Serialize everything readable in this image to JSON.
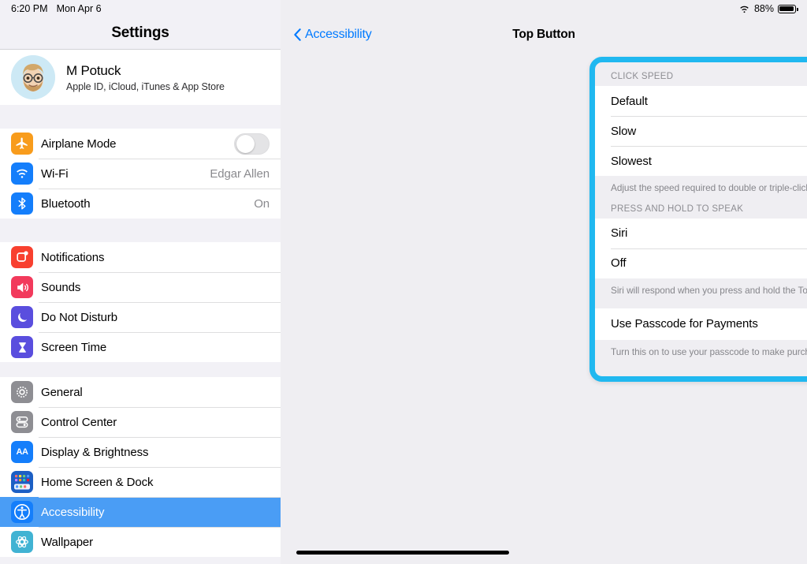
{
  "status_bar": {
    "time": "6:20 PM",
    "date": "Mon Apr 6",
    "wifi_icon": "wifi-icon",
    "battery_percent": "88%",
    "battery_icon": "battery-icon"
  },
  "sidebar": {
    "title": "Settings",
    "profile": {
      "name": "M Potuck",
      "subtitle": "Apple ID, iCloud, iTunes & App Store",
      "avatar_icon": "memoji-avatar"
    },
    "groups": [
      {
        "items": [
          {
            "label": "Airplane Mode",
            "icon": "airplane-icon",
            "icon_color": "#f89c1c",
            "control": "toggle",
            "toggle_on": false,
            "value": ""
          },
          {
            "label": "Wi-Fi",
            "icon": "wifi-icon",
            "icon_color": "#147efb",
            "control": "value",
            "value": "Edgar Allen"
          },
          {
            "label": "Bluetooth",
            "icon": "bluetooth-icon",
            "icon_color": "#147efb",
            "control": "value",
            "value": "On"
          }
        ]
      },
      {
        "items": [
          {
            "label": "Notifications",
            "icon": "notifications-icon",
            "icon_color": "#f8402f",
            "control": "none",
            "value": ""
          },
          {
            "label": "Sounds",
            "icon": "sounds-icon",
            "icon_color": "#f23a5c",
            "control": "none",
            "value": ""
          },
          {
            "label": "Do Not Disturb",
            "icon": "moon-icon",
            "icon_color": "#5a4ede",
            "control": "none",
            "value": ""
          },
          {
            "label": "Screen Time",
            "icon": "hourglass-icon",
            "icon_color": "#5a4ede",
            "control": "none",
            "value": ""
          }
        ]
      },
      {
        "items": [
          {
            "label": "General",
            "icon": "gear-icon",
            "icon_color": "#8e8e93",
            "control": "none",
            "value": ""
          },
          {
            "label": "Control Center",
            "icon": "control-center-icon",
            "icon_color": "#8e8e93",
            "control": "none",
            "value": ""
          },
          {
            "label": "Display & Brightness",
            "icon": "display-brightness-icon",
            "icon_color": "#147efb",
            "control": "none",
            "value": ""
          },
          {
            "label": "Home Screen & Dock",
            "icon": "home-screen-dock-icon",
            "icon_color": "#1c5fc4",
            "control": "none",
            "value": ""
          },
          {
            "label": "Accessibility",
            "icon": "accessibility-icon",
            "icon_color": "#147efb",
            "control": "none",
            "value": "",
            "selected": true
          },
          {
            "label": "Wallpaper",
            "icon": "wallpaper-icon",
            "icon_color": "#41b3d3",
            "control": "none",
            "value": ""
          }
        ]
      }
    ]
  },
  "detail": {
    "back_label": "Accessibility",
    "back_icon": "chevron-left-icon",
    "title": "Top Button",
    "highlight_color": "#20b8f0",
    "sections": [
      {
        "header": "CLICK SPEED",
        "rows": [
          {
            "label": "Default",
            "checked": true
          },
          {
            "label": "Slow",
            "checked": false
          },
          {
            "label": "Slowest",
            "checked": false
          }
        ],
        "footnote": "Adjust the speed required to double or triple-click the Top Button."
      },
      {
        "header": "PRESS AND HOLD TO SPEAK",
        "rows": [
          {
            "label": "Siri",
            "checked": true
          },
          {
            "label": "Off",
            "checked": false
          }
        ],
        "footnote": "Siri will respond when you press and hold the Top Button."
      },
      {
        "header": "",
        "rows": [
          {
            "label": "Use Passcode for Payments",
            "control": "toggle",
            "toggle_on": false
          }
        ],
        "footnote": "Turn this on to use your passcode to make purchases instead of double-clicking the Top Button."
      }
    ]
  }
}
